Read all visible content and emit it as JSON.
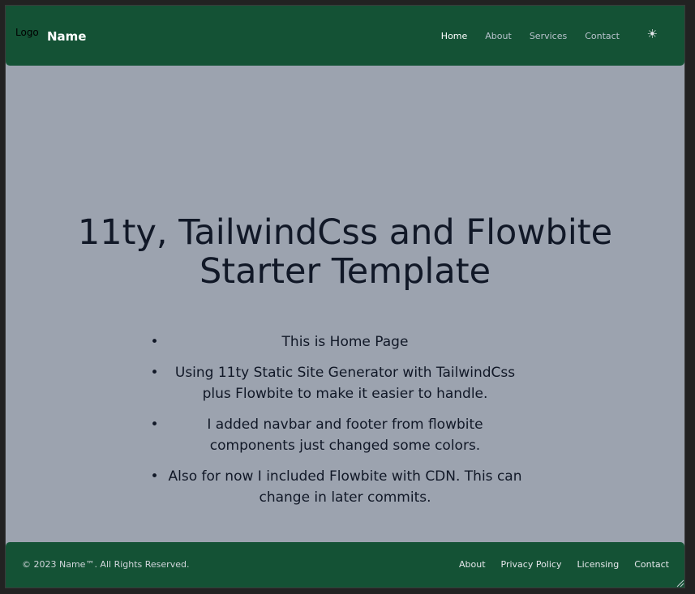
{
  "navbar": {
    "logo_text": "Logo",
    "brand": "Name",
    "links": [
      {
        "label": "Home",
        "active": true
      },
      {
        "label": "About",
        "active": false
      },
      {
        "label": "Services",
        "active": false
      },
      {
        "label": "Contact",
        "active": false
      }
    ],
    "theme_toggle_icon": "sun-icon",
    "theme_toggle_glyph": "☀"
  },
  "hero": {
    "title": "11ty, TailwindCss and Flowbite Starter Template",
    "items": [
      "This is Home Page",
      "Using 11ty Static Site Generator with TailwindCss plus Flowbite to make it easier to handle.",
      "I added navbar and footer from flowbite components just changed some colors.",
      "Also for now I included Flowbite with CDN. This can change in later commits."
    ]
  },
  "footer": {
    "copyright": "© 2023 Name™. All Rights Reserved.",
    "links": [
      "About",
      "Privacy Policy",
      "Licensing",
      "Contact"
    ]
  },
  "colors": {
    "navbar_bg": "#145235",
    "page_bg": "#9ca3af",
    "text_dark": "#111827"
  }
}
